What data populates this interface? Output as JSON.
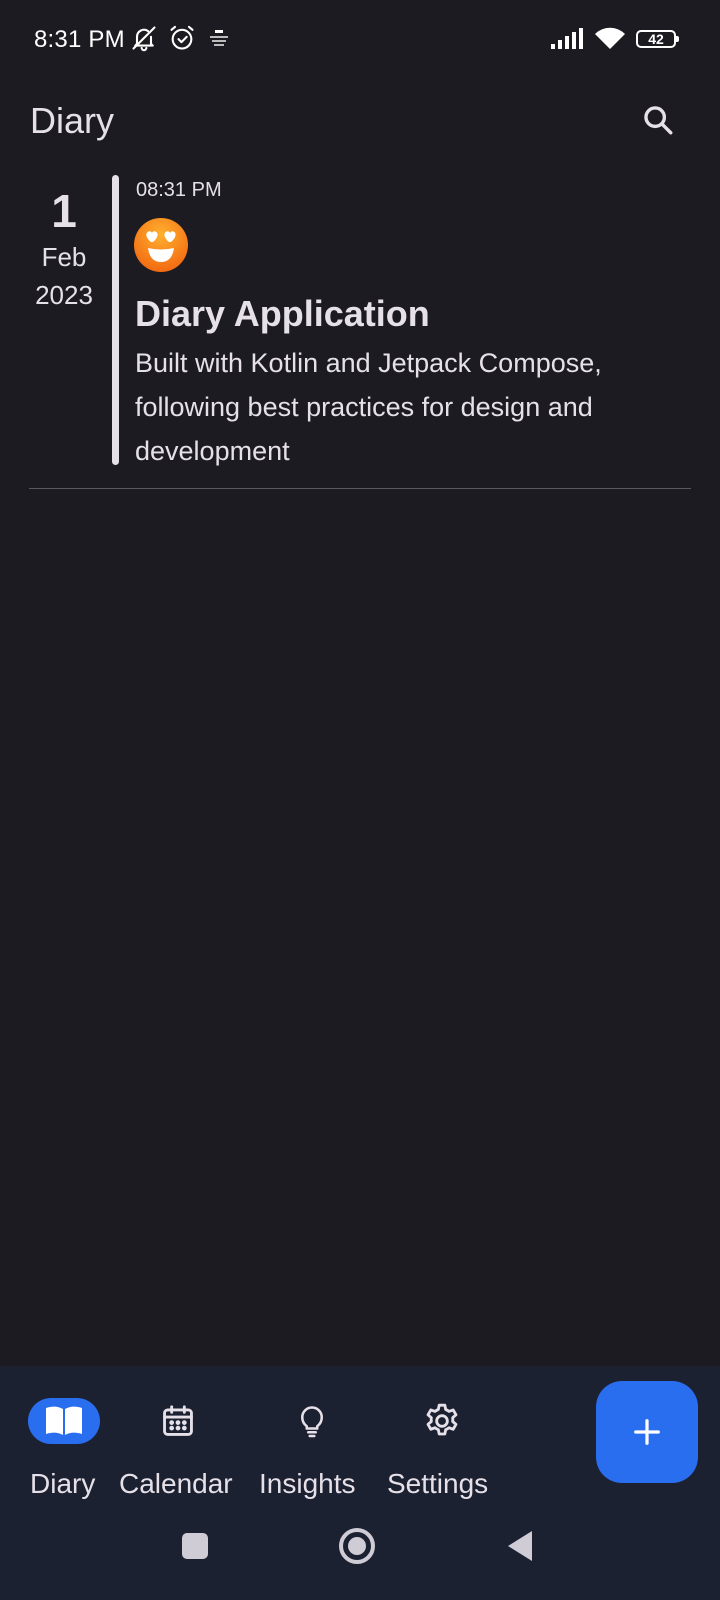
{
  "status_bar": {
    "time": "8:31 PM",
    "battery_level": "42",
    "icons_left": [
      "bell-off-icon",
      "alarm-icon",
      "app-notification-icon"
    ],
    "icons_right": [
      "signal-icon",
      "wifi-icon",
      "battery-icon"
    ]
  },
  "app_bar": {
    "title": "Diary",
    "search_icon": "search-icon"
  },
  "entries": [
    {
      "day": "1",
      "month": "Feb",
      "year": "2023",
      "time": "08:31 PM",
      "mood_icon": "heart-eyes-face-icon",
      "title": "Diary Application",
      "body": "Built with Kotlin and Jetpack Compose, following best practices for design and development"
    }
  ],
  "bottom_nav": {
    "items": [
      {
        "label": "Diary",
        "icon": "book-icon",
        "active": true
      },
      {
        "label": "Calendar",
        "icon": "calendar-icon",
        "active": false
      },
      {
        "label": "Insights",
        "icon": "lightbulb-icon",
        "active": false
      },
      {
        "label": "Settings",
        "icon": "gear-icon",
        "active": false
      }
    ],
    "fab_icon": "plus-icon"
  },
  "system_nav": [
    "recents-icon",
    "home-icon",
    "back-icon"
  ],
  "colors": {
    "background": "#1c1b21",
    "nav_background": "#1c2132",
    "accent": "#2a6ef0",
    "text": "#e6e1e8"
  }
}
